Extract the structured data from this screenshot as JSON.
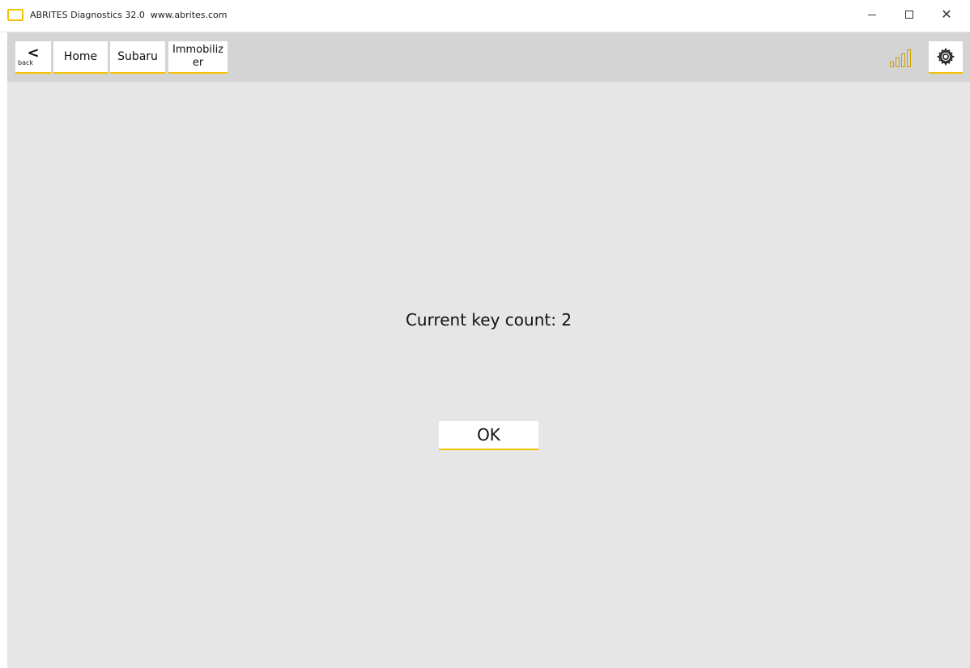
{
  "window": {
    "title": "ABRITES Diagnostics 32.0  www.abrites.com",
    "minimize": "–",
    "close": "✕"
  },
  "toolbar": {
    "back_label": "back",
    "back_glyph": "<",
    "home_label": "Home",
    "subaru_label": "Subaru",
    "immobilizer_line1": "Immobiliz",
    "immobilizer_line2": "er",
    "signal_icon": "signal-strength-icon",
    "settings_icon": "gear-icon"
  },
  "main": {
    "message": "Current key count: 2",
    "ok_label": "OK"
  },
  "colors": {
    "accent": "#f2c200",
    "toolbar_bg": "#d4d4d4",
    "content_bg": "#e6e6e6"
  }
}
